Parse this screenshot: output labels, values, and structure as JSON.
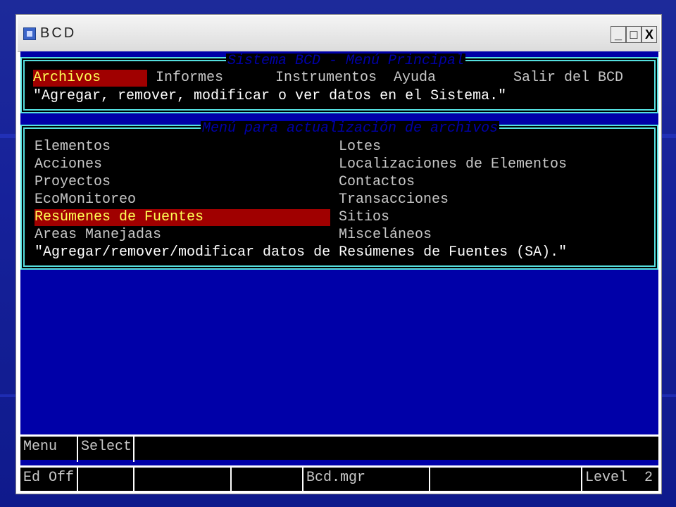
{
  "window": {
    "title": "BCD",
    "minimize": "_",
    "maximize": "□",
    "close": "X"
  },
  "main_menu": {
    "title": "Sistema BCD - Menú Principal",
    "items": [
      "Archivos",
      "Informes",
      "Instrumentos",
      "Ayuda",
      "Salir del BCD"
    ],
    "selected": "Archivos",
    "description": "\"Agregar, remover, modificar o ver datos en el Sistema.\""
  },
  "files_menu": {
    "title": "Menú para actualización de archivos",
    "left_items": [
      "Elementos",
      "Acciones",
      "Proyectos",
      "EcoMonitoreo",
      "Resúmenes de Fuentes",
      "Areas Manejadas"
    ],
    "right_items": [
      "Lotes",
      "Localizaciones de Elementos",
      "Contactos",
      "Transacciones",
      "Sitios",
      "Misceláneos"
    ],
    "selected": "Resúmenes de Fuentes",
    "description": "\"Agregar/remover/modificar datos de Resúmenes de Fuentes (SA).\""
  },
  "status_bar": {
    "row1": [
      "Menu",
      "Select"
    ],
    "row2": [
      "Ed Off",
      "",
      "",
      "",
      "Bcd.mgr",
      "",
      "Level  2"
    ]
  },
  "colors": {
    "terminal_bg": "#0000a8",
    "highlight": "#a00000",
    "selected_text": "#ffff55",
    "border": "#55e0e0"
  }
}
